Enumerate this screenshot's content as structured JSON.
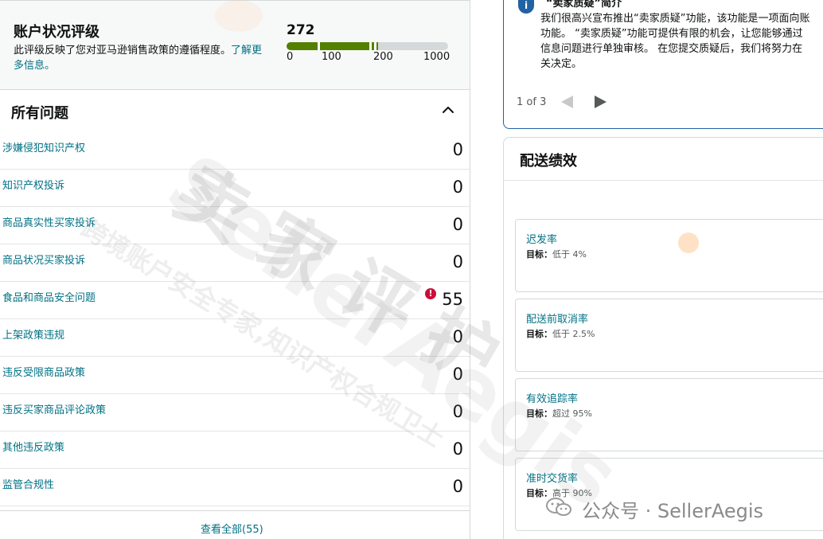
{
  "account_health": {
    "title": "账户状况评级",
    "description": "此评级反映了您对亚马逊销售政策的遵循程度。",
    "learn_more": "了解更多信息。",
    "score": "272",
    "score_value": 272,
    "scale_max": 1000,
    "ticks": [
      "0",
      "100",
      "200",
      "1000"
    ],
    "colors": {
      "fill": "#538000",
      "track": "#d5d9d9"
    }
  },
  "issues": {
    "title": "所有问题",
    "chevron_icon": "chevron-up-icon",
    "rows": [
      {
        "label": "涉嫌侵犯知识产权",
        "value": "0",
        "alert": false
      },
      {
        "label": "知识产权投诉",
        "value": "0",
        "alert": false
      },
      {
        "label": "商品真实性买家投诉",
        "value": "0",
        "alert": false
      },
      {
        "label": "商品状况买家投诉",
        "value": "0",
        "alert": false
      },
      {
        "label": "食品和商品安全问题",
        "value": "55",
        "alert": true
      },
      {
        "label": "上架政策违规",
        "value": "0",
        "alert": false
      },
      {
        "label": "违反受限商品政策",
        "value": "0",
        "alert": false
      },
      {
        "label": "违反买家商品评论政策",
        "value": "0",
        "alert": false
      },
      {
        "label": "其他违反政策",
        "value": "0",
        "alert": false
      },
      {
        "label": "监管合规性",
        "value": "0",
        "alert": false
      }
    ],
    "view_all": "查看全部(55)",
    "alert_color": "#cc0c39"
  },
  "notice": {
    "title": "“卖家质疑”简介",
    "body": "我们很高兴宣布推出“卖家质疑”功能，该功能是一项面向账\n功能。 “卖家质疑”功能可提供有限的机会，让您能够通过\n信息问题进行单独审核。 在您提交质疑后，我们将努力在\n关决定。",
    "pager": "1 of 3",
    "icon": "info-icon"
  },
  "delivery": {
    "title": "配送绩效",
    "metrics": [
      {
        "name": "迟发率",
        "target_label": "目标：",
        "target": "低于 4%"
      },
      {
        "name": "配送前取消率",
        "target_label": "目标：",
        "target": "低于 2.5%"
      },
      {
        "name": "有效追踪率",
        "target_label": "目标：",
        "target": "超过 95%"
      },
      {
        "name": "准时交货率",
        "target_label": "目标：",
        "target": "高于 90%"
      }
    ]
  },
  "watermarks": {
    "seller": "SellerAegis",
    "big": "卖家评护",
    "line": "跨境账户安全专家,知识产权合规卫士",
    "bottom": "公众号 · SellerAegis"
  }
}
